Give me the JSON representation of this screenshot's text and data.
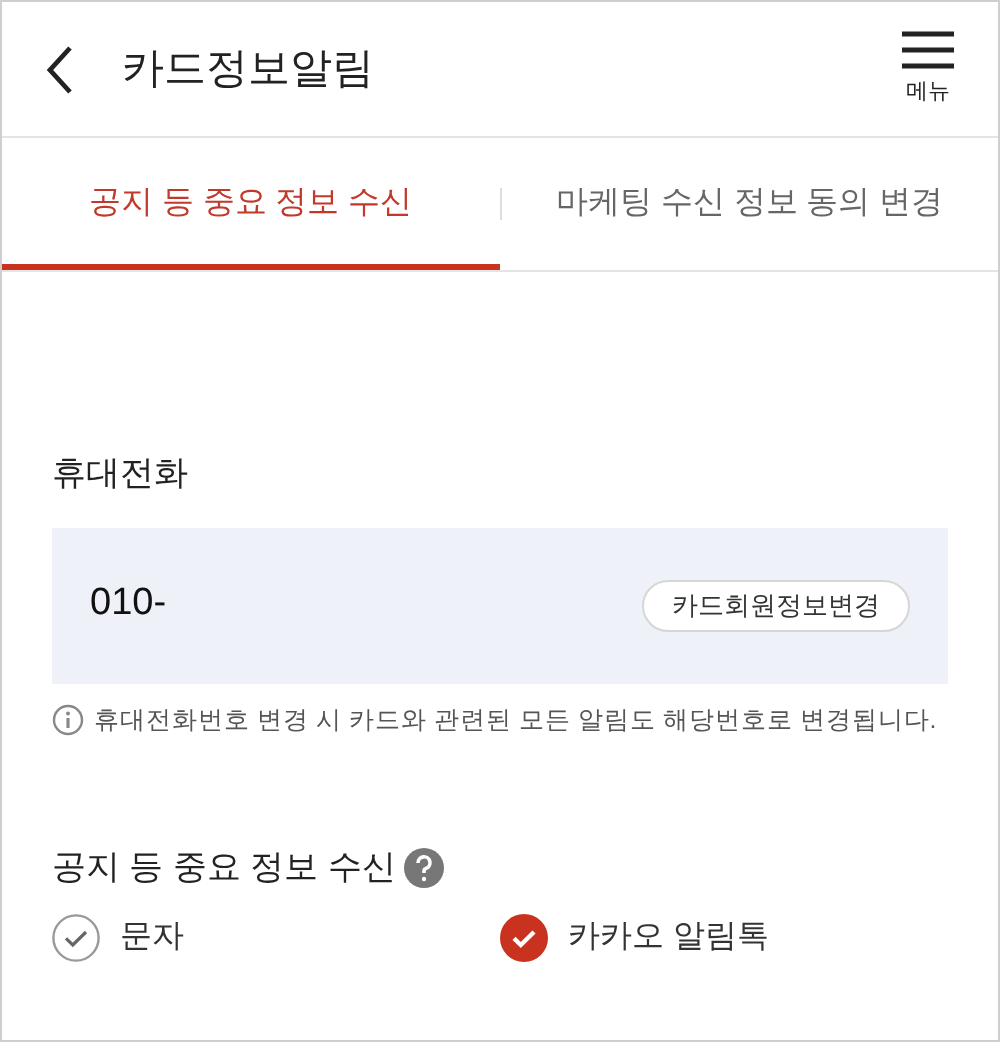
{
  "header": {
    "title": "카드정보알림",
    "menu_label": "메뉴"
  },
  "tabs": [
    {
      "label": "공지 등 중요 정보 수신",
      "selected": true
    },
    {
      "label": "마케팅 수신 정보 동의 변경",
      "selected": false
    }
  ],
  "phone_section": {
    "title": "휴대전화",
    "value": "010-",
    "button": "카드회원정보변경",
    "note": "휴대전화번호 변경 시 카드와 관련된 모든 알림도 해당번호로 변경됩니다."
  },
  "receive_section": {
    "title": "공지 등 중요 정보 수신",
    "options": [
      {
        "label": "문자",
        "checked": false
      },
      {
        "label": "카카오 알림톡",
        "checked": true
      }
    ]
  }
}
